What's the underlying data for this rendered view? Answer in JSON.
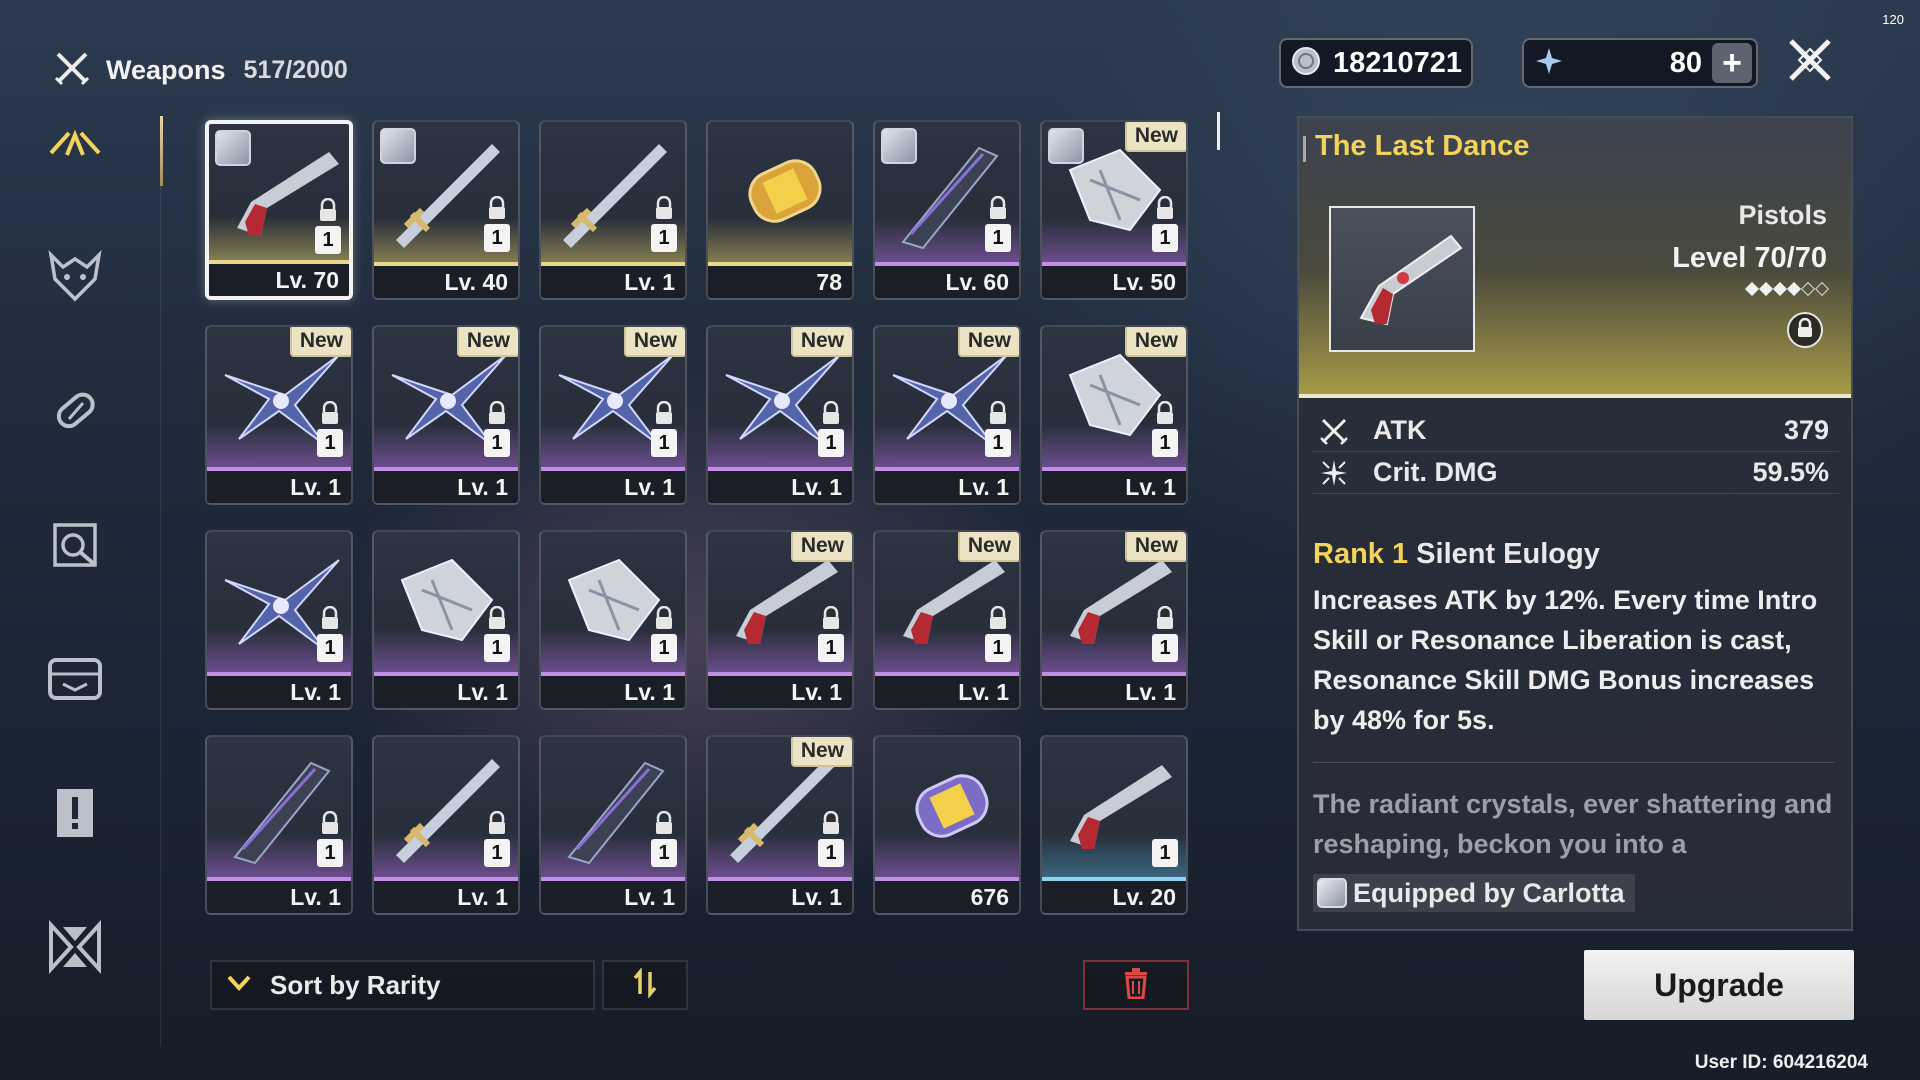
{
  "header": {
    "title": "Weapons",
    "count": "517/2000"
  },
  "sidebar": {
    "items": [
      {
        "icon": "weapons-crossed-icon",
        "active": true
      },
      {
        "icon": "echo-mask-icon",
        "active": false
      },
      {
        "icon": "upgrade-material-icon",
        "active": false
      },
      {
        "icon": "development-item-icon",
        "active": false
      },
      {
        "icon": "resource-box-icon",
        "active": false
      },
      {
        "icon": "quest-item-icon",
        "active": false
      },
      {
        "icon": "special-item-icon",
        "active": false
      }
    ]
  },
  "currency": {
    "shell_credits": "18210721",
    "astrite": "80",
    "plus_label": "+"
  },
  "fps": "120",
  "inventory": {
    "new_label": "New",
    "cards": [
      {
        "footer": "Lv. 70",
        "qty": "1",
        "rarity": "r5",
        "new": false,
        "avatar": true,
        "locked": true,
        "selected": true,
        "art": "pistol"
      },
      {
        "footer": "Lv. 40",
        "qty": "1",
        "rarity": "r5",
        "new": false,
        "avatar": true,
        "locked": true,
        "selected": false,
        "art": "sword"
      },
      {
        "footer": "Lv. 1",
        "qty": "1",
        "rarity": "r5",
        "new": false,
        "avatar": false,
        "locked": true,
        "selected": false,
        "art": "sword"
      },
      {
        "footer": "78",
        "qty": "",
        "rarity": "r5",
        "new": false,
        "avatar": false,
        "locked": false,
        "selected": false,
        "art": "capsule-gold"
      },
      {
        "footer": "Lv. 60",
        "qty": "1",
        "rarity": "r4",
        "new": false,
        "avatar": true,
        "locked": true,
        "selected": false,
        "art": "broadblade"
      },
      {
        "footer": "Lv. 50",
        "qty": "1",
        "rarity": "r4",
        "new": true,
        "avatar": true,
        "locked": true,
        "selected": false,
        "art": "gauntlet"
      },
      {
        "footer": "Lv. 1",
        "qty": "1",
        "rarity": "r4",
        "new": true,
        "avatar": false,
        "locked": true,
        "selected": false,
        "art": "rectifier"
      },
      {
        "footer": "Lv. 1",
        "qty": "1",
        "rarity": "r4",
        "new": true,
        "avatar": false,
        "locked": true,
        "selected": false,
        "art": "rectifier"
      },
      {
        "footer": "Lv. 1",
        "qty": "1",
        "rarity": "r4",
        "new": true,
        "avatar": false,
        "locked": true,
        "selected": false,
        "art": "rectifier"
      },
      {
        "footer": "Lv. 1",
        "qty": "1",
        "rarity": "r4",
        "new": true,
        "avatar": false,
        "locked": true,
        "selected": false,
        "art": "rectifier"
      },
      {
        "footer": "Lv. 1",
        "qty": "1",
        "rarity": "r4",
        "new": true,
        "avatar": false,
        "locked": true,
        "selected": false,
        "art": "rectifier"
      },
      {
        "footer": "Lv. 1",
        "qty": "1",
        "rarity": "r4",
        "new": true,
        "avatar": false,
        "locked": true,
        "selected": false,
        "art": "gauntlet"
      },
      {
        "footer": "Lv. 1",
        "qty": "1",
        "rarity": "r4",
        "new": false,
        "avatar": false,
        "locked": true,
        "selected": false,
        "art": "rectifier"
      },
      {
        "footer": "Lv. 1",
        "qty": "1",
        "rarity": "r4",
        "new": false,
        "avatar": false,
        "locked": true,
        "selected": false,
        "art": "gauntlet"
      },
      {
        "footer": "Lv. 1",
        "qty": "1",
        "rarity": "r4",
        "new": false,
        "avatar": false,
        "locked": true,
        "selected": false,
        "art": "gauntlet"
      },
      {
        "footer": "Lv. 1",
        "qty": "1",
        "rarity": "r4",
        "new": true,
        "avatar": false,
        "locked": true,
        "selected": false,
        "art": "pistol"
      },
      {
        "footer": "Lv. 1",
        "qty": "1",
        "rarity": "r4",
        "new": true,
        "avatar": false,
        "locked": true,
        "selected": false,
        "art": "pistol"
      },
      {
        "footer": "Lv. 1",
        "qty": "1",
        "rarity": "r4",
        "new": true,
        "avatar": false,
        "locked": true,
        "selected": false,
        "art": "pistol"
      },
      {
        "footer": "Lv. 1",
        "qty": "1",
        "rarity": "r4",
        "new": false,
        "avatar": false,
        "locked": true,
        "selected": false,
        "art": "broadblade"
      },
      {
        "footer": "Lv. 1",
        "qty": "1",
        "rarity": "r4",
        "new": false,
        "avatar": false,
        "locked": true,
        "selected": false,
        "art": "sword"
      },
      {
        "footer": "Lv. 1",
        "qty": "1",
        "rarity": "r4",
        "new": false,
        "avatar": false,
        "locked": true,
        "selected": false,
        "art": "broadblade"
      },
      {
        "footer": "Lv. 1",
        "qty": "1",
        "rarity": "r4",
        "new": true,
        "avatar": false,
        "locked": true,
        "selected": false,
        "art": "sword"
      },
      {
        "footer": "676",
        "qty": "",
        "rarity": "r4",
        "new": false,
        "avatar": false,
        "locked": false,
        "selected": false,
        "art": "capsule-purple"
      },
      {
        "footer": "Lv. 20",
        "qty": "1",
        "rarity": "r3",
        "new": false,
        "avatar": false,
        "locked": false,
        "selected": false,
        "art": "pistol"
      }
    ]
  },
  "sort": {
    "label": "Sort by Rarity"
  },
  "detail": {
    "name": "The Last Dance",
    "type": "Pistols",
    "level_label": "Level",
    "level": "70/70",
    "ascension": {
      "filled": 4,
      "total": 6
    },
    "stats": [
      {
        "icon": "atk-icon",
        "name": "ATK",
        "value": "379"
      },
      {
        "icon": "crit-dmg-icon",
        "name": "Crit. DMG",
        "value": "59.5%"
      }
    ],
    "passive_rank": "Rank 1",
    "passive_name": "Silent Eulogy",
    "passive_desc": "Increases ATK by 12%. Every time Intro Skill or Resonance Liberation is cast, Resonance Skill DMG Bonus increases by 48% for 5s.",
    "flavor": "The radiant crystals, ever shattering and reshaping, beckon you into a",
    "equipped_by": "Equipped by Carlotta"
  },
  "upgrade_label": "Upgrade",
  "user_id": "User ID: 604216204",
  "colors": {
    "accent_gold": "#f3d35a",
    "rarity_5": "#e8d98a",
    "rarity_4": "#c38fe6",
    "rarity_3": "#8fd3f2",
    "danger": "#e04848"
  }
}
